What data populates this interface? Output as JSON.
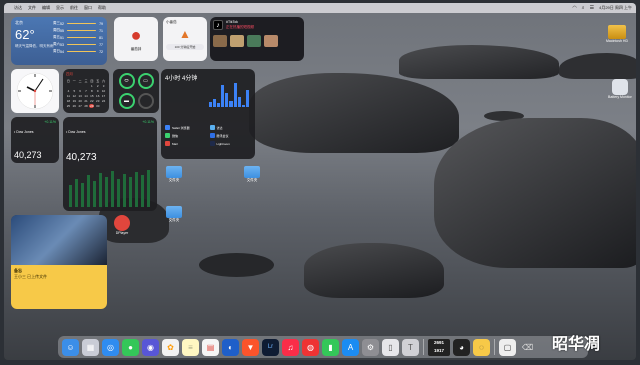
{
  "menubar": {
    "items": [
      "访达",
      "文件",
      "编辑",
      "显示",
      "前往",
      "窗口",
      "帮助"
    ],
    "status_right": "4月29日 周四 上午",
    "icons": [
      "wifi-icon",
      "search-icon",
      "control-center-icon",
      "siri-icon"
    ]
  },
  "weather": {
    "location": "北京",
    "temperature": "62°",
    "description": "晴天气温降低，明天有雨",
    "forecast": [
      {
        "day": "周三",
        "low": "52",
        "high": "79"
      },
      {
        "day": "周四",
        "low": "55",
        "high": "71"
      },
      {
        "day": "周五",
        "low": "51",
        "high": "81"
      },
      {
        "day": "周六",
        "low": "53",
        "high": "77"
      },
      {
        "day": "周日",
        "low": "54",
        "high": "72"
      }
    ]
  },
  "tomato": {
    "label": "番茄钟"
  },
  "todo": {
    "title": "小番茄",
    "item": "100 分钟后开始"
  },
  "tiktok": {
    "title": "#TikTok",
    "subtitle": "正在热播的短视频"
  },
  "calendar": {
    "month": "四月",
    "days": [
      "日",
      "一",
      "二",
      "三",
      "四",
      "五",
      "六",
      "",
      "",
      "",
      "",
      "1",
      "2",
      "3",
      "4",
      "5",
      "6",
      "7",
      "8",
      "9",
      "10",
      "11",
      "12",
      "13",
      "14",
      "15",
      "16",
      "17",
      "18",
      "19",
      "20",
      "21",
      "22",
      "23",
      "24",
      "25",
      "26",
      "27",
      "28",
      "29",
      "30"
    ]
  },
  "screentime": {
    "total": "4小时 4分钟",
    "apps": [
      {
        "name": "Safari 浏览器",
        "color": "#3c82f6"
      },
      {
        "name": "访达",
        "color": "#5ab0f0"
      },
      {
        "name": "微信",
        "color": "#3bd16f"
      },
      {
        "name": "腾讯会议",
        "color": "#2f6fe6"
      },
      {
        "name": "Mail",
        "color": "#e0463d"
      },
      {
        "name": "Lightroom",
        "color": "#1e2a4a"
      }
    ]
  },
  "stocks": {
    "small": {
      "name": "• Dow Jones",
      "change": "+0.11%",
      "value": "40,273"
    },
    "large": {
      "name": "• Dow Jones",
      "change": "+0.11%",
      "value": "40,273"
    }
  },
  "note": {
    "title": "备忘",
    "text": "王小三 已上传文件"
  },
  "desktop": {
    "folder1": "文件夹",
    "folder2": "文件夹",
    "folder3": "文件夹",
    "disk": "Macintosh HD",
    "app": "Battery Monitor",
    "music": "DPlayer"
  },
  "dock": {
    "counter_top": "2691",
    "counter_bottom": "1917"
  },
  "watermark": "昭华凋"
}
